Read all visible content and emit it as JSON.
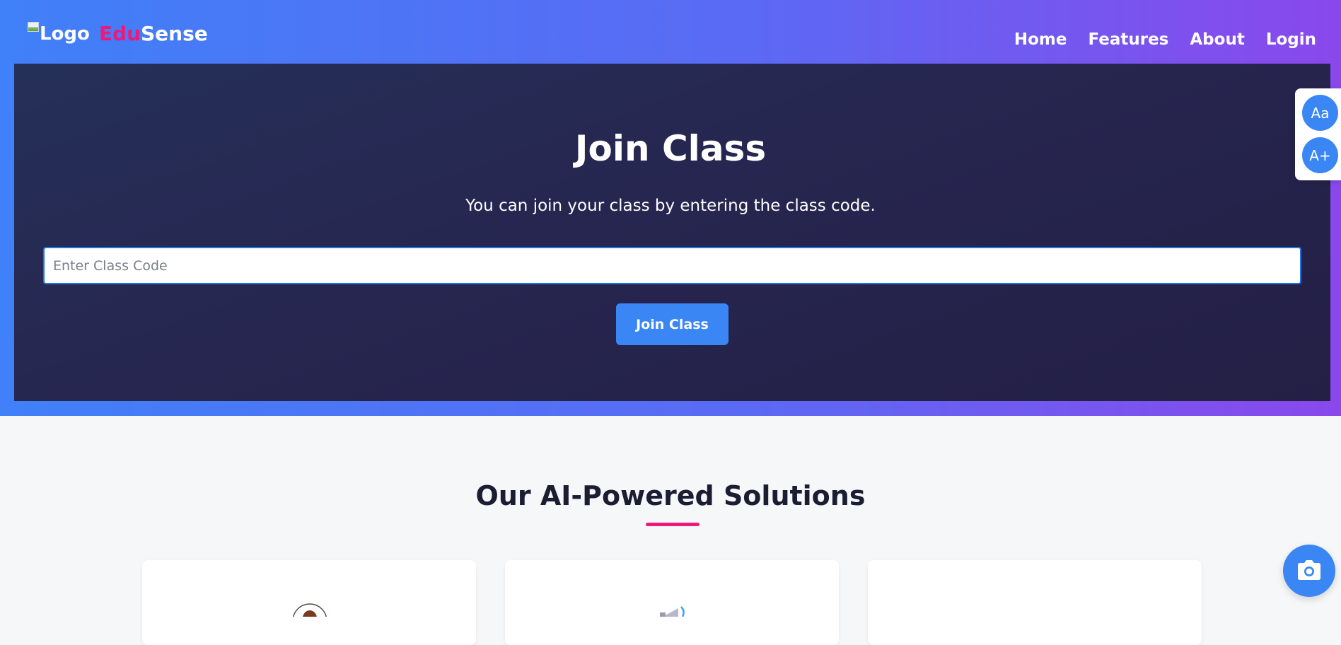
{
  "header": {
    "logo_alt": "Logo",
    "brand_part1": "Edu",
    "brand_part2": "Sense",
    "nav": [
      "Home",
      "Features",
      "About",
      "Login"
    ]
  },
  "join": {
    "title": "Join Class",
    "description": "You can join your class by entering the class code.",
    "input_placeholder": "Enter Class Code",
    "input_value": "",
    "button_label": "Join Class"
  },
  "accessibility": {
    "font_toggle_label": "Aa",
    "font_increase_label": "A+"
  },
  "solutions": {
    "title": "Our AI-Powered Solutions"
  },
  "floating": {
    "camera_icon": "camera-icon"
  },
  "colors": {
    "primary": "#3a86f5",
    "accent": "#ec1a7a",
    "panel_dark": "#262650"
  }
}
